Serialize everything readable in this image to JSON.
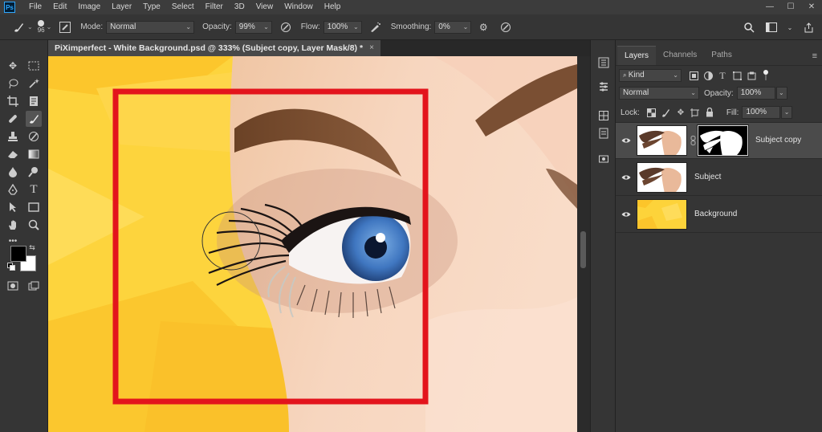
{
  "app": {
    "logo": "Ps",
    "menu": [
      "File",
      "Edit",
      "Image",
      "Layer",
      "Type",
      "Select",
      "Filter",
      "3D",
      "View",
      "Window",
      "Help"
    ],
    "window_controls": [
      "—",
      "☐",
      "✕"
    ]
  },
  "options": {
    "brush_size": "96",
    "mode_label": "Mode:",
    "mode_value": "Normal",
    "opacity_label": "Opacity:",
    "opacity_value": "99%",
    "flow_label": "Flow:",
    "flow_value": "100%",
    "smoothing_label": "Smoothing:",
    "smoothing_value": "0%"
  },
  "document": {
    "tab_title": "PiXimperfect - White Background.psd @ 333% (Subject copy, Layer Mask/8) *",
    "tab_close": "×"
  },
  "colors": {
    "foreground": "#000000",
    "background": "#ffffff",
    "highlight_box": "#e3141c",
    "canvas_yellow": "#fdd33a"
  },
  "layers_panel": {
    "tabs": [
      "Layers",
      "Channels",
      "Paths"
    ],
    "active_tab": "Layers",
    "filter_value": "Kind",
    "blend_mode": "Normal",
    "opacity_label": "Opacity:",
    "opacity_value": "100%",
    "lock_label": "Lock:",
    "fill_label": "Fill:",
    "fill_value": "100%",
    "layers": [
      {
        "name": "Subject copy",
        "visible": true,
        "selected": true,
        "has_mask": true
      },
      {
        "name": "Subject",
        "visible": true,
        "selected": false,
        "has_mask": false
      },
      {
        "name": "Background",
        "visible": true,
        "selected": false,
        "has_mask": false
      }
    ]
  }
}
